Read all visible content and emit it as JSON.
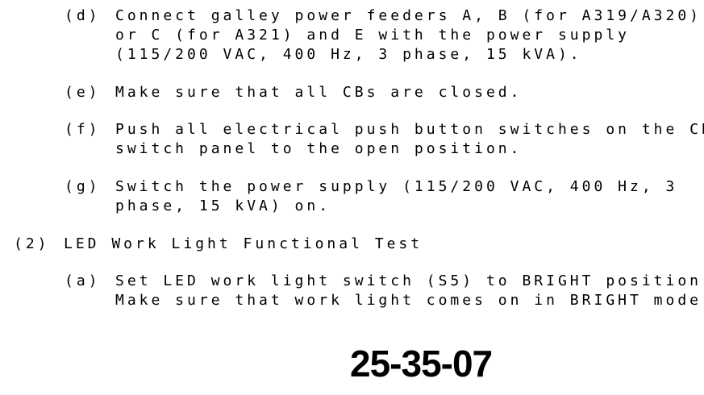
{
  "steps": [
    {
      "marker": "(d)",
      "lines": [
        "Connect galley power feeders A, B (for A319/A320)",
        "or C (for A321) and E with the power supply",
        "(115/200 VAC, 400 Hz, 3 phase, 15 kVA)."
      ]
    },
    {
      "marker": "(e)",
      "lines": [
        "Make sure that all CBs are closed."
      ]
    },
    {
      "marker": "(f)",
      "lines": [
        "Push all electrical push button switches on the CB",
        "switch panel to the open position."
      ]
    },
    {
      "marker": "(g)",
      "lines": [
        "Switch the power supply (115/200 VAC, 400 Hz, 3",
        "phase, 15 kVA) on."
      ]
    }
  ],
  "section": {
    "marker": "(2)",
    "title": "LED Work Light Functional Test"
  },
  "section_steps": [
    {
      "marker": "(a)",
      "lines": [
        "Set LED work light switch (S5) to BRIGHT position.",
        "Make sure that work light comes on in BRIGHT mode."
      ]
    }
  ],
  "footer": {
    "code": "25-35-07"
  }
}
